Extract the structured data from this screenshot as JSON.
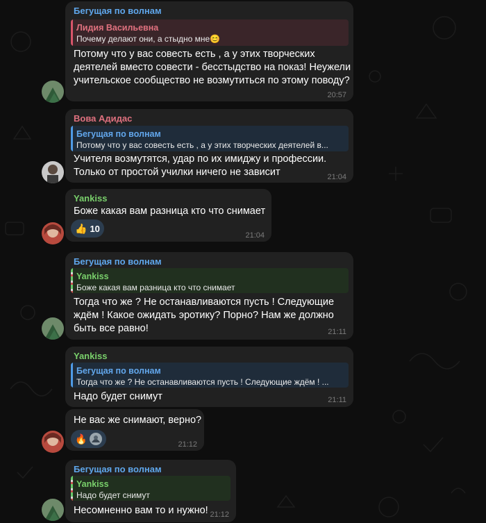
{
  "messages": [
    {
      "sender": "Бегущая по волнам",
      "reply": {
        "name": "Лидия Васильевна",
        "text": "Почему делают они, а стыдно мне😊"
      },
      "lines": [
        "Потому что у вас совесть есть , а у этих творческих",
        "деятелей вместо совести - бесстыдство на показ! Неужели",
        "учительское сообщество не возмутиться по этому поводу?"
      ],
      "time": "20:57"
    },
    {
      "sender": "Вова Адидас",
      "reply": {
        "name": "Бегущая по волнам",
        "text": "Потому что у вас совесть есть , а у этих творческих деятелей в..."
      },
      "lines": [
        "Учителя возмутятся, удар по их имиджу и профессии.",
        "Только от простой училки ничего не зависит"
      ],
      "time": "21:04"
    },
    {
      "sender": "Yankiss",
      "lines": [
        "Боже какая вам разница кто что снимает"
      ],
      "reaction": {
        "emoji": "👍",
        "count": "10"
      },
      "time": "21:04"
    },
    {
      "sender": "Бегущая по волнам",
      "reply": {
        "name": "Yankiss",
        "text": "Боже какая вам разница кто что снимает"
      },
      "lines": [
        "Тогда что же ? Не останавливаются пусть ! Следующие",
        "ждём ! Какое ожидать эротику? Порно? Нам же должно",
        "быть все равно!"
      ],
      "time": "21:11"
    },
    {
      "sender": "Yankiss",
      "reply": {
        "name": "Бегущая по волнам",
        "text": "Тогда что же ? Не останавливаются пусть ! Следующие ждём ! ..."
      },
      "lines": [
        "Надо будет снимут"
      ],
      "time": "21:11"
    },
    {
      "lines": [
        "Не вас же снимают, верно?"
      ],
      "reaction": {
        "emoji": "🔥"
      },
      "time": "21:12"
    },
    {
      "sender": "Бегущая по волнам",
      "reply": {
        "name": "Yankiss",
        "text": "Надо будет снимут"
      },
      "lines": [
        "Несомненно вам то и нужно!"
      ],
      "time": "21:12"
    }
  ],
  "colors": {
    "background": "#0e0e0e",
    "bubble": "#212121",
    "name_blue": "#5fa7ec",
    "name_red": "#e0717f",
    "name_green": "#79cf6b",
    "time": "#7c7c7c"
  }
}
